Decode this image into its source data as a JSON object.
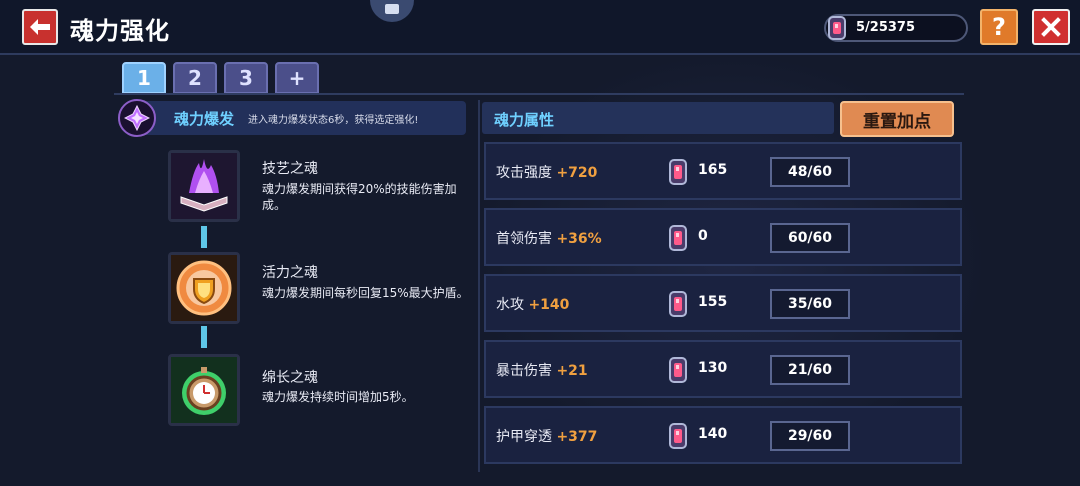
{
  "header": {
    "title": "魂力强化",
    "currency_value": "5/25375"
  },
  "tabs": [
    {
      "label": "1",
      "active": true
    },
    {
      "label": "2",
      "active": false
    },
    {
      "label": "3",
      "active": false
    },
    {
      "label": "+",
      "active": false
    }
  ],
  "burst": {
    "title": "魂力爆发",
    "description": "进入魂力爆发状态6秒，获得选定强化!"
  },
  "souls": [
    {
      "name": "技艺之魂",
      "description": "魂力爆发期间获得20%的技能伤害加成。",
      "icon": "purple-flame-book-icon"
    },
    {
      "name": "活力之魂",
      "description": "魂力爆发期间每秒回复15%最大护盾。",
      "icon": "orange-shield-icon"
    },
    {
      "name": "绵长之魂",
      "description": "魂力爆发持续时间增加5秒。",
      "icon": "green-stopwatch-icon"
    }
  ],
  "attributes": {
    "header": "魂力属性",
    "reset_label": "重置加点",
    "rows": [
      {
        "name": "攻击强度",
        "bonus": "+720",
        "cost": "165",
        "level": "48/60"
      },
      {
        "name": "首领伤害",
        "bonus": "+36%",
        "cost": "0",
        "level": "60/60"
      },
      {
        "name": "水攻",
        "bonus": "+140",
        "cost": "155",
        "level": "35/60"
      },
      {
        "name": "暴击伤害",
        "bonus": "+21",
        "cost": "130",
        "level": "21/60"
      },
      {
        "name": "护甲穿透",
        "bonus": "+377",
        "cost": "140",
        "level": "29/60"
      }
    ]
  },
  "colors": {
    "accent_blue": "#6fd0ff",
    "bonus_orange": "#f0a040",
    "reset_button": "#e08a52",
    "close_button": "#d03030",
    "help_button": "#e07a2a"
  }
}
